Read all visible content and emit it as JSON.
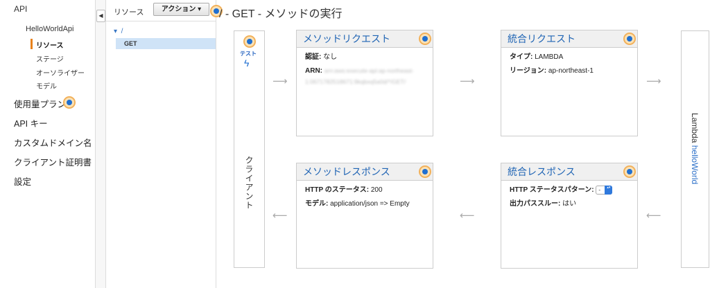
{
  "nav": {
    "top": "API",
    "api_name": "HelloWorldApi",
    "sub_items": [
      "リソース",
      "ステージ",
      "オーソライザー",
      "モデル"
    ],
    "main_items": [
      "使用量プラン",
      "API キー",
      "カスタムドメイン名",
      "クライアント証明書",
      "設定"
    ]
  },
  "tree": {
    "label": "リソース",
    "actions": "アクション",
    "root": "/",
    "method": "GET"
  },
  "main": {
    "title": "/ - GET - メソッドの実行",
    "client": {
      "test": "テスト",
      "label": "クライアント"
    },
    "method_request": {
      "title": "メソッドリクエスト",
      "auth_label": "認証:",
      "auth_value": "なし",
      "arn_label": "ARN:",
      "arn_value": "arn:aws:execute-api:ap-northeast-1:0671782518671:9kqbxq5a0d/*/GET/"
    },
    "integration_request": {
      "title": "統合リクエスト",
      "type_label": "タイプ:",
      "type_value": "LAMBDA",
      "region_label": "リージョン:",
      "region_value": "ap-northeast-1"
    },
    "method_response": {
      "title": "メソッドレスポンス",
      "status_label": "HTTP のステータス:",
      "status_value": "200",
      "model_label": "モデル:",
      "model_value": "application/json => Empty"
    },
    "integration_response": {
      "title": "統合レスポンス",
      "pattern_label": "HTTP ステータスパターン:",
      "pattern_value": "-",
      "passthrough_label": "出力パススルー:",
      "passthrough_value": "はい"
    },
    "lambda": {
      "prefix": "Lambda",
      "function": "helloWorld"
    }
  },
  "colors": {
    "accent_orange": "#e8821c",
    "link_blue": "#1f64b4",
    "selected_row": "#cfe3f7"
  }
}
